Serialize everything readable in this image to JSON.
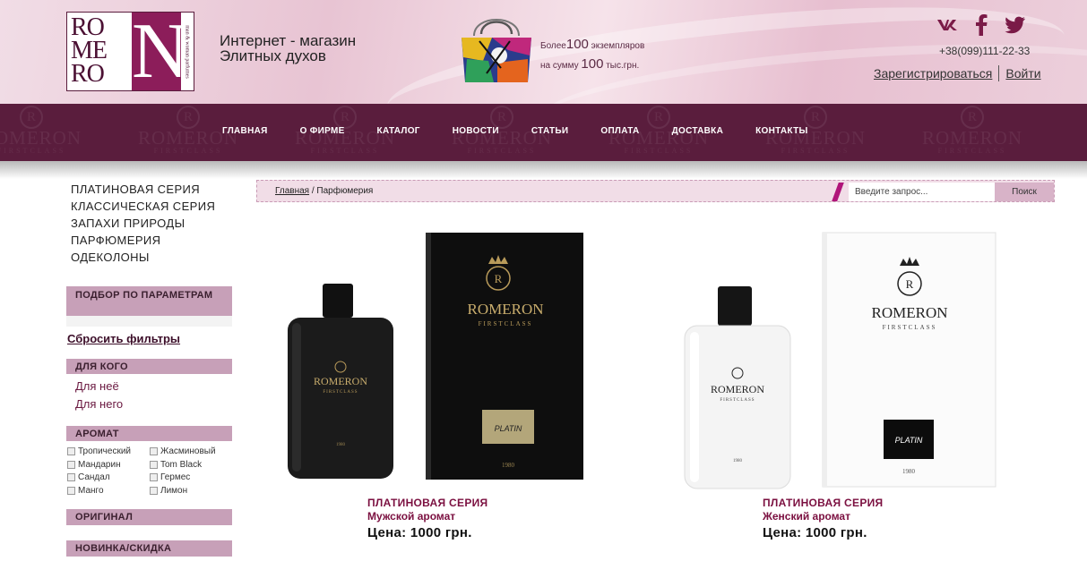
{
  "header": {
    "logo": {
      "lines": [
        "RO",
        "ME",
        "RO"
      ],
      "letter": "N",
      "side_text": "man & woman parfumes"
    },
    "tagline": [
      "Интернет - магазин",
      "Элитных духов"
    ],
    "promo": {
      "line1_prefix": "Более",
      "line1_number": "100",
      "line1_suffix": " экземпляров",
      "line2_prefix": "на сумму ",
      "line2_number": "100",
      "line2_suffix": " тыс.грн."
    },
    "social": [
      {
        "icon": "vk-icon",
        "glyph": "vk"
      },
      {
        "icon": "facebook-icon",
        "glyph": "f"
      },
      {
        "icon": "twitter-icon",
        "glyph": "t"
      }
    ],
    "phone": "+38(099)111-22-33",
    "register_label": "Зарегистрироваться",
    "login_label": "Войти"
  },
  "nav": {
    "watermark": {
      "letter": "R",
      "name": "ROMERON",
      "sub": "FIRSTCLASS"
    },
    "items": [
      "ГЛАВНАЯ",
      "О ФИРМЕ",
      "КАТАЛОГ",
      "НОВОСТИ",
      "СТАТЬИ",
      "ОПЛАТА",
      "ДОСТАВКА",
      "КОНТАКТЫ"
    ]
  },
  "sidebar": {
    "categories": [
      "ПЛАТИНОВАЯ СЕРИЯ",
      "КЛАССИЧЕСКАЯ СЕРИЯ",
      "ЗАПАХИ ПРИРОДЫ",
      "ПАРФЮМЕРИЯ",
      "ОДЕКОЛОНЫ"
    ],
    "filter_heading": "ПОДБОР ПО ПАРАМЕТРАМ",
    "reset_label": "Сбросить фильтры",
    "for_whom_heading": "ДЛЯ КОГО",
    "for_whom": [
      "Для неё",
      "Для него"
    ],
    "aroma_heading": "АРОМАТ",
    "aromas": [
      "Тропический",
      "Жасминовый",
      "Мандарин",
      "Tom Black",
      "Сандал",
      "Гермес",
      "Манго",
      "Лимон"
    ],
    "original_heading": "ОРИГИНАЛ",
    "new_heading": "НОВИНКА/СКИДКА"
  },
  "breadcrumb": {
    "home": "Главная",
    "separator": " / ",
    "current": "Парфюмерия"
  },
  "search": {
    "placeholder": "Введите запрос...",
    "button_label": "Поиск"
  },
  "products": [
    {
      "series": "ПЛАТИНОВАЯ СЕРИЯ",
      "type": "Мужской аромат",
      "price": "Цена: 1000 грн.",
      "theme": "black",
      "brand": "ROMERON",
      "brand_sub": "FIRSTCLASS",
      "label": "PLATIN",
      "year": "1980"
    },
    {
      "series": "ПЛАТИНОВАЯ СЕРИЯ",
      "type": "Женский аромат",
      "price": "Цена: 1000 грн.",
      "theme": "white",
      "brand": "ROMERON",
      "brand_sub": "FIRSTCLASS",
      "label": "PLATIN",
      "year": "1980"
    }
  ],
  "colors": {
    "nav_bg": "#5a1d3d",
    "accent": "#7b1040",
    "sidebar_heading": "#c7a0b8",
    "breadcrumb_bg": "#f1dde7"
  }
}
